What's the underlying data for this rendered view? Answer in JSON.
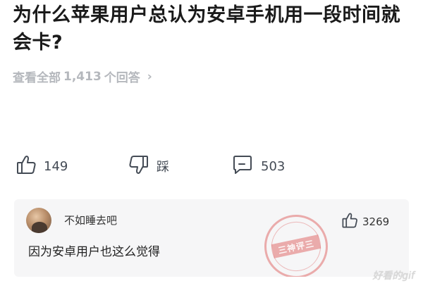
{
  "question": {
    "title": "为什么苹果用户总认为安卓手机用一段时间就会卡?"
  },
  "answers_link": {
    "prefix": "查看全部",
    "count": "1,413",
    "suffix": "个回答",
    "chevron": "›"
  },
  "actions": {
    "like": {
      "icon": "thumbs-up-icon",
      "count": "149"
    },
    "dislike": {
      "icon": "thumbs-down-icon",
      "label": "踩"
    },
    "comment": {
      "icon": "comment-icon",
      "count": "503"
    }
  },
  "top_comment": {
    "username": "不如睡去吧",
    "like_count": "3269",
    "text": "因为安卓用户也这么觉得",
    "stamp_text": "三神评三"
  },
  "watermark": "好看的gif",
  "colors": {
    "muted_text": "#b5b8bd",
    "icon_stroke": "#444b55",
    "card_bg": "#f6f6f7",
    "stamp_red": "#e06e6e"
  }
}
